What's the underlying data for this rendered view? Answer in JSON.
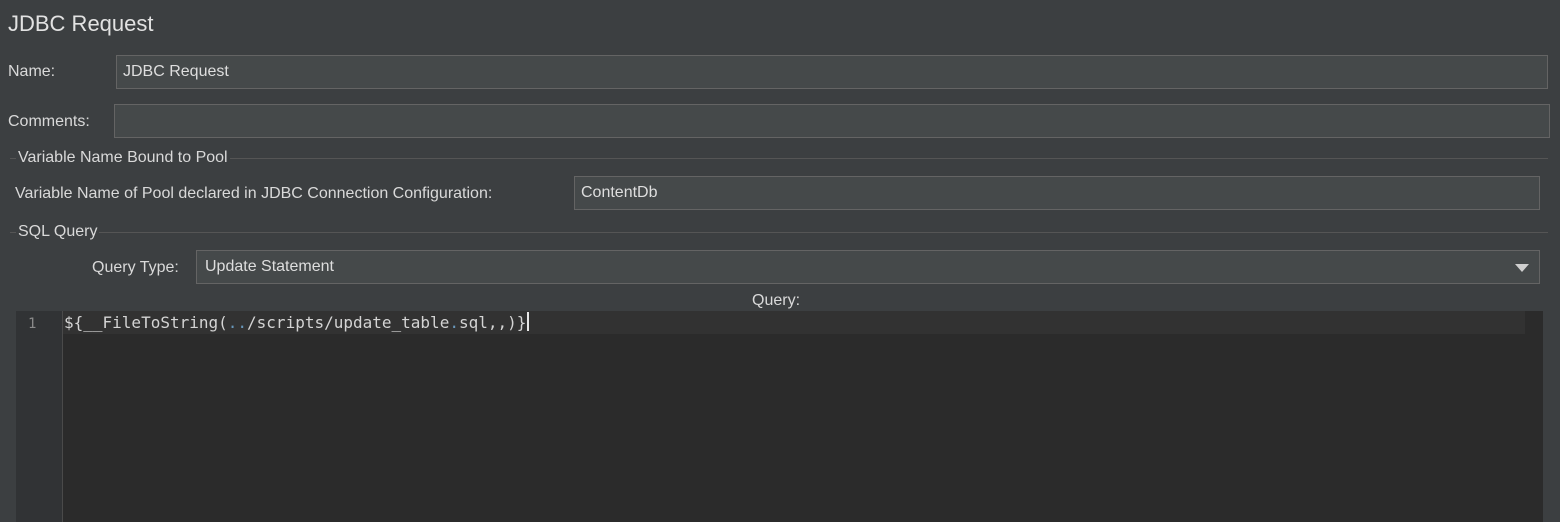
{
  "panel": {
    "title": "JDBC Request"
  },
  "name_field": {
    "label": "Name:",
    "value": "JDBC Request"
  },
  "comments_field": {
    "label": "Comments:",
    "value": ""
  },
  "pool_group": {
    "title": "Variable Name Bound to Pool",
    "pool_label": "Variable Name of Pool declared in JDBC Connection Configuration:",
    "pool_value": "ContentDb"
  },
  "sql_group": {
    "title": "SQL Query",
    "query_type_label": "Query Type:",
    "query_type_value": "Update Statement",
    "query_label": "Query:"
  },
  "editor": {
    "line_number": "1",
    "code_prefix": "${__FileToString(",
    "code_dots": "..",
    "code_middle": "/scripts/update_table",
    "code_dot2": ".",
    "code_suffix": "sql,,)}"
  },
  "icons": {
    "dropdown": "chevron-down-icon"
  }
}
